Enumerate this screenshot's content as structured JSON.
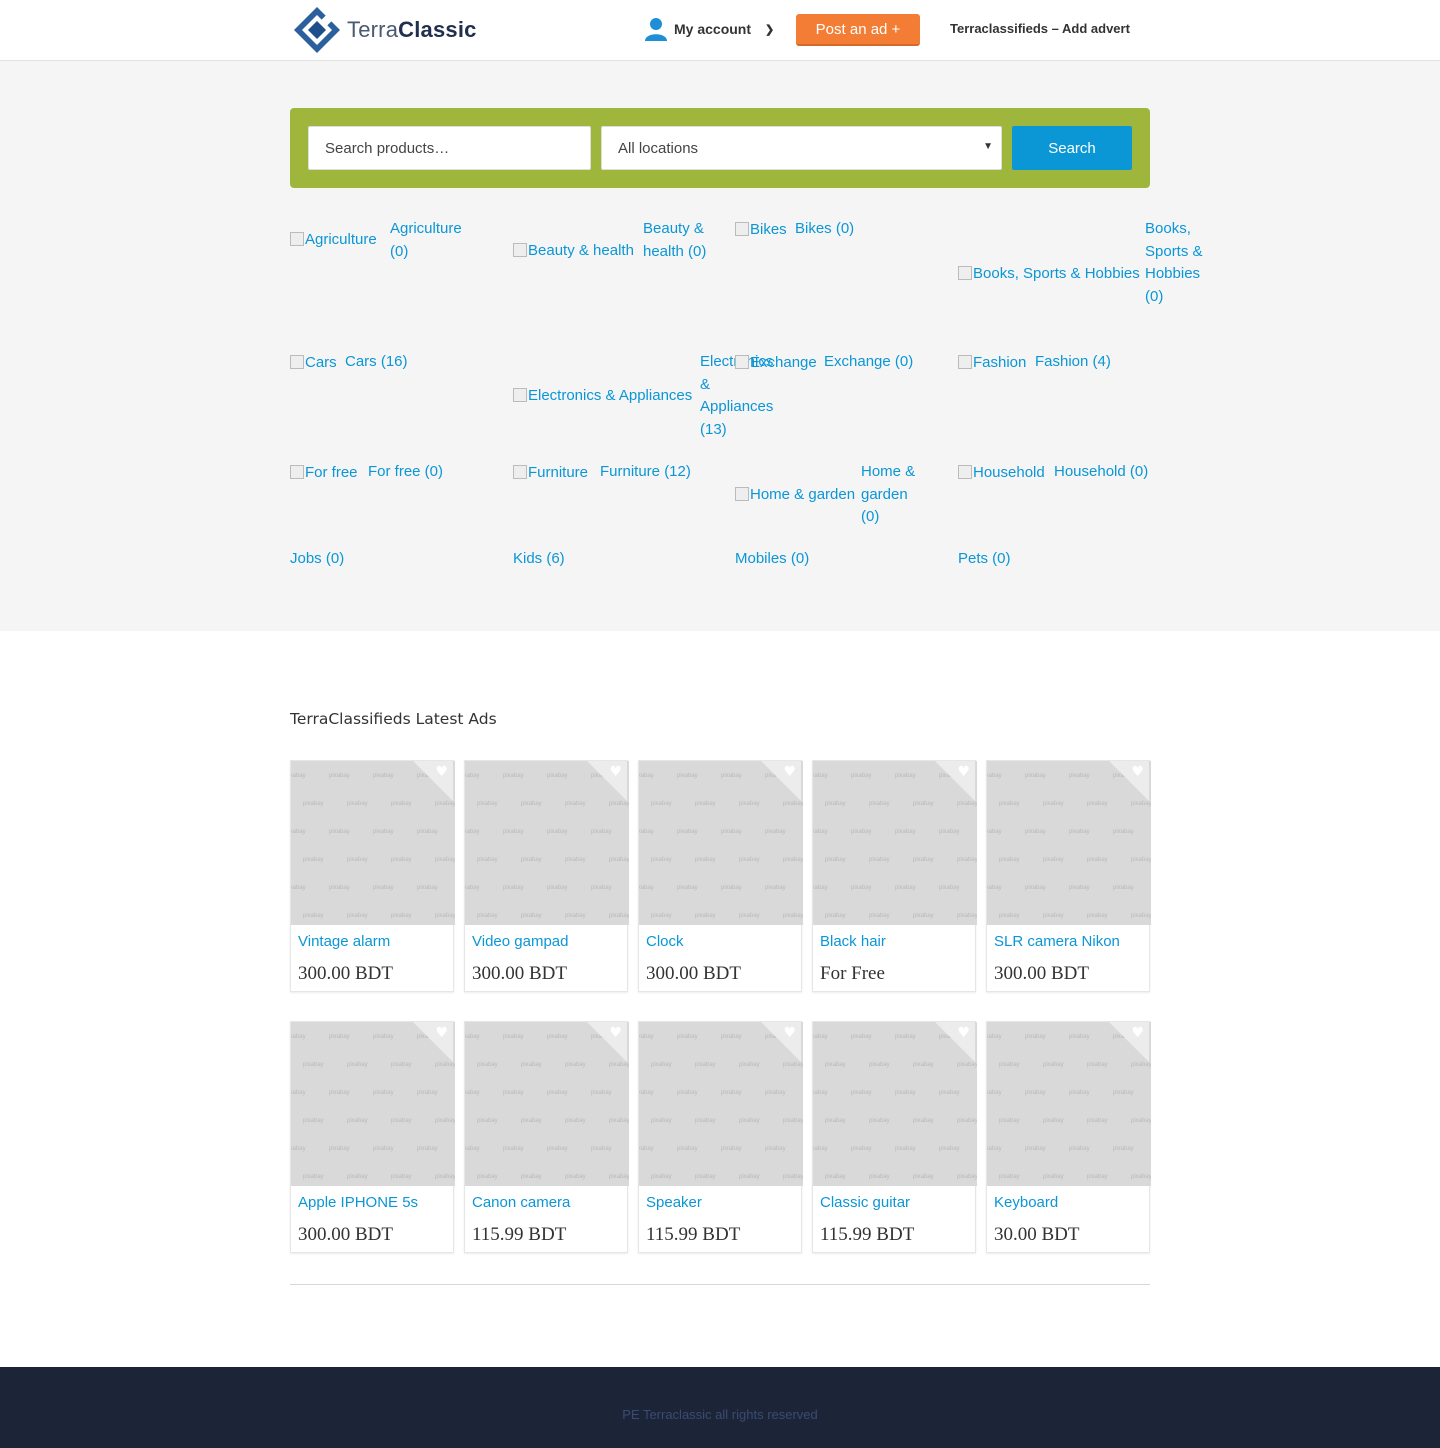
{
  "header": {
    "logo_light": "Terra",
    "logo_bold": "Classic",
    "account_label": "My account",
    "post_ad_label": "Post an ad +",
    "add_advert_label": "Terraclassifieds – Add advert"
  },
  "search": {
    "input_placeholder": "Search products…",
    "location_selected": "All locations",
    "button_label": "Search"
  },
  "categories": [
    {
      "img_alt": "Agriculture",
      "label": "Agriculture (0)"
    },
    {
      "img_alt": "Beauty & health",
      "label": "Beauty & health (0)"
    },
    {
      "img_alt": "Bikes",
      "label": "Bikes (0)"
    },
    {
      "img_alt": "Books, Sports & Hobbies",
      "label": "Books, Sports & Hobbies (0)"
    },
    {
      "img_alt": "Cars",
      "label": "Cars (16)"
    },
    {
      "img_alt": "Electronics & Appliances",
      "label": "Electronics & Appliances (13)"
    },
    {
      "img_alt": "Exchange",
      "label": "Exchange (0)"
    },
    {
      "img_alt": "Fashion",
      "label": "Fashion (4)"
    },
    {
      "img_alt": "For free",
      "label": "For free (0)"
    },
    {
      "img_alt": "Furniture",
      "label": "Furniture (12)"
    },
    {
      "img_alt": "Home & garden",
      "label": "Home & garden (0)"
    },
    {
      "img_alt": "Household",
      "label": "Household (0)"
    },
    {
      "img_alt": "",
      "label": "Jobs (0)"
    },
    {
      "img_alt": "",
      "label": "Kids (6)"
    },
    {
      "img_alt": "",
      "label": "Mobiles (0)"
    },
    {
      "img_alt": "",
      "label": "Pets (0)"
    }
  ],
  "latest": {
    "title": "TerraClassifieds Latest Ads",
    "watermark": "pixabay",
    "ads": [
      {
        "title": "Vintage alarm",
        "price": "300.00 BDT"
      },
      {
        "title": "Video gampad",
        "price": "300.00 BDT"
      },
      {
        "title": "Clock",
        "price": "300.00 BDT"
      },
      {
        "title": "Black hair",
        "price": "For Free"
      },
      {
        "title": "SLR camera Nikon",
        "price": "300.00 BDT"
      },
      {
        "title": "Apple IPHONE 5s",
        "price": "300.00 BDT"
      },
      {
        "title": "Canon camera",
        "price": "115.99 BDT"
      },
      {
        "title": "Speaker",
        "price": "115.99 BDT"
      },
      {
        "title": "Classic guitar",
        "price": "115.99 BDT"
      },
      {
        "title": "Keyboard",
        "price": "30.00 BDT"
      }
    ]
  },
  "footer": {
    "text": "PE Terraclassic all rights reserved"
  },
  "colors": {
    "accent_blue": "#0b96d6",
    "post_orange": "#f47d35",
    "search_green": "#9fb63d",
    "footer_navy": "#1c2538"
  }
}
